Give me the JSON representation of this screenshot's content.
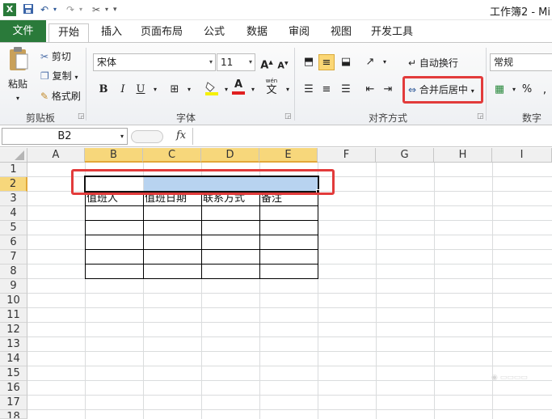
{
  "window": {
    "title": "工作簿2 - Mi"
  },
  "quick_access": {
    "customize": "▾"
  },
  "tabs": [
    "开始",
    "插入",
    "页面布局",
    "公式",
    "数据",
    "审阅",
    "视图",
    "开发工具"
  ],
  "file_tab": "文件",
  "ribbon": {
    "clipboard": {
      "paste": "粘贴",
      "cut": "剪切",
      "copy": "复制",
      "format_painter": "格式刷",
      "label": "剪贴板"
    },
    "font": {
      "name": "宋体",
      "size": "11",
      "bold": "B",
      "italic": "I",
      "underline": "U",
      "wen": "wén",
      "wen_char": "文",
      "label": "字体"
    },
    "alignment": {
      "wrap": "自动换行",
      "merge": "合并后居中",
      "label": "对齐方式"
    },
    "number": {
      "format": "常规",
      "percent": "%",
      "label": "数字"
    }
  },
  "formula_bar": {
    "name_box": "B2",
    "fx": "fx",
    "value": ""
  },
  "grid": {
    "columns": [
      "A",
      "B",
      "C",
      "D",
      "E",
      "F",
      "G",
      "H",
      "I"
    ],
    "rows": [
      "1",
      "2",
      "3",
      "4",
      "5",
      "6",
      "7",
      "8",
      "9",
      "10",
      "11",
      "12",
      "13",
      "14",
      "15",
      "16",
      "17",
      "18"
    ],
    "selected_cell": "B2",
    "headers_row3": [
      "值班人",
      "值班日期",
      "联系方式",
      "备注"
    ]
  },
  "colors": {
    "file_tab": "#2a7a3a",
    "highlight": "#e23b3b",
    "selection": "#b8d3f0"
  }
}
